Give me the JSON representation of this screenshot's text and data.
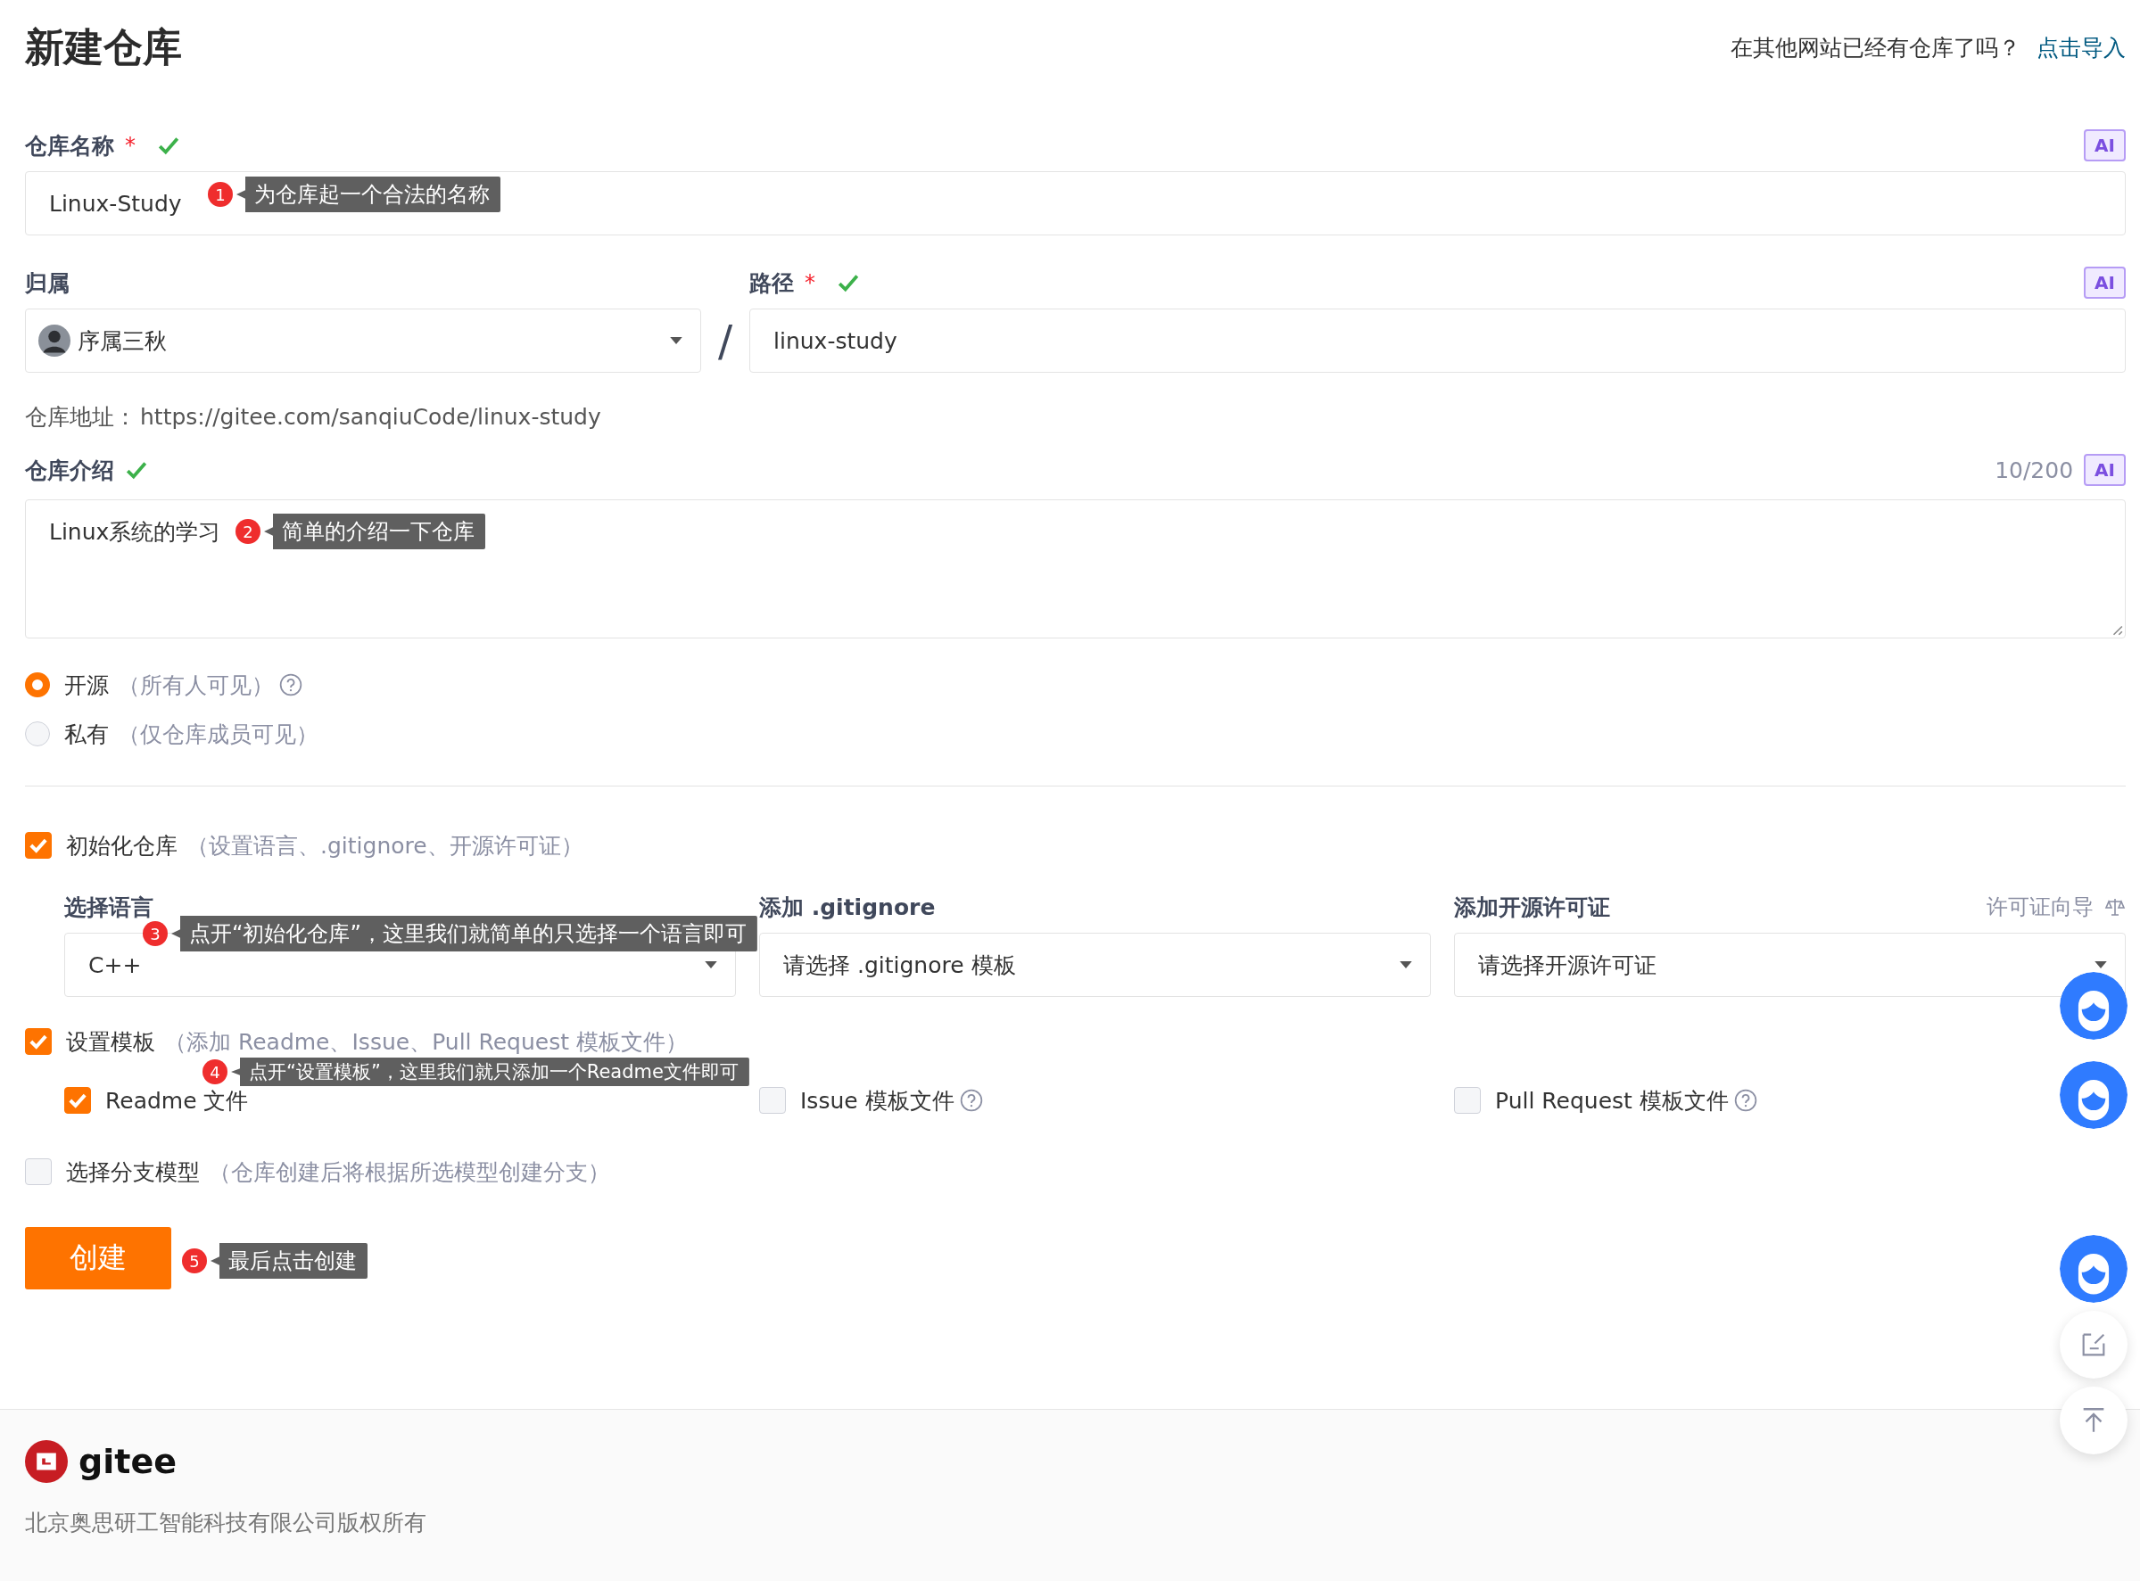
{
  "page_title": "新建仓库",
  "import_prompt": {
    "text": "在其他网站已经有仓库了吗？",
    "link": "点击导入"
  },
  "name_field": {
    "label": "仓库名称",
    "required_mark": "*",
    "valid": true,
    "ai_badge": "AI",
    "value": "Linux-Study"
  },
  "owner_field": {
    "label": "归属",
    "value": "序属三秋"
  },
  "separator": "/",
  "path_field": {
    "label": "路径",
    "required_mark": "*",
    "valid": true,
    "ai_badge": "AI",
    "value": "linux-study"
  },
  "repo_url": {
    "label": "仓库地址：",
    "value": "https://gitee.com/sanqiuCode/linux-study"
  },
  "description_field": {
    "label": "仓库介绍",
    "valid": true,
    "counter": "10/200",
    "ai_badge": "AI",
    "value": "Linux系统的学习"
  },
  "visibility": [
    {
      "label": "开源",
      "hint": "（所有人可见）",
      "help": true,
      "selected": true
    },
    {
      "label": "私有",
      "hint": "（仅仓库成员可见）",
      "help": false,
      "selected": false
    }
  ],
  "init_repo": {
    "label": "初始化仓库",
    "hint": "（设置语言、.gitignore、开源许可证）",
    "checked": true
  },
  "init_options": [
    {
      "label": "选择语言",
      "value": "C++"
    },
    {
      "label": "添加 .gitignore",
      "placeholder": "请选择 .gitignore 模板"
    },
    {
      "label": "添加开源许可证",
      "placeholder": "请选择开源许可证",
      "extra": "许可证向导"
    }
  ],
  "template": {
    "label": "设置模板",
    "hint": "（添加 Readme、Issue、Pull Request 模板文件）",
    "checked": true
  },
  "template_files": [
    {
      "label": "Readme 文件",
      "checked": true,
      "help": false
    },
    {
      "label": "Issue 模板文件",
      "checked": false,
      "help": true
    },
    {
      "label": "Pull Request 模板文件",
      "checked": false,
      "help": true
    }
  ],
  "branch_model": {
    "label": "选择分支模型",
    "hint": "（仓库创建后将根据所选模型创建分支）",
    "checked": false
  },
  "create_button": "创建",
  "annotations": [
    {
      "number": "1",
      "text": "为仓库起一个合法的名称"
    },
    {
      "number": "2",
      "text": "简单的介绍一下仓库"
    },
    {
      "number": "3",
      "text": "点开“初始化仓库”，这里我们就简单的只选择一个语言即可"
    },
    {
      "number": "4",
      "text": "点开“设置模板”，这里我们就只添加一个Readme文件即可"
    },
    {
      "number": "5",
      "text": "最后点击创建"
    }
  ],
  "footer": {
    "brand": "gitee",
    "copyright": "北京奥思研工智能科技有限公司版权所有"
  }
}
